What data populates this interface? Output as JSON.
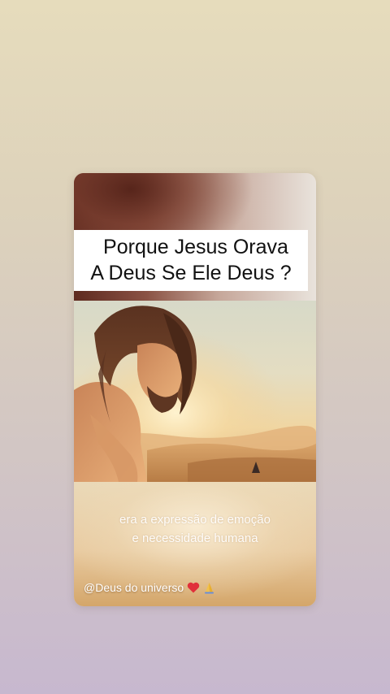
{
  "post": {
    "title_line1": "Porque Jesus Orava",
    "title_line2": "A Deus Se Ele Deus ?",
    "caption_line1": "era a expressão de emoção",
    "caption_line2": "e necessidade humana",
    "handle": "@Deus do universo"
  },
  "icons": {
    "heart": "heart-icon",
    "pray": "praying-hands-icon"
  },
  "colors": {
    "page_top": "#e6dcbc",
    "page_bottom": "#c7b8cf",
    "title_bg": "#ffffff",
    "title_text": "#111111",
    "caption_text": "#ffffff",
    "heart": "#e0303a"
  }
}
